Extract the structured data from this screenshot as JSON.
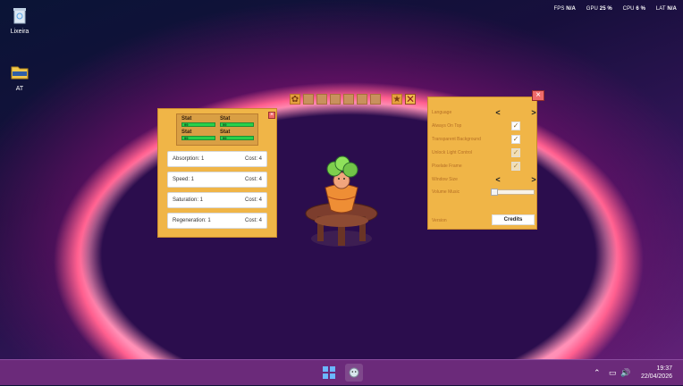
{
  "desktop": {
    "recycle_bin_label": "Lixeira",
    "folder_label": "AT"
  },
  "hud": {
    "fps_label": "FPS",
    "fps_value": "N/A",
    "gpu_label": "GPU",
    "gpu_value": "25 %",
    "cpu_label": "CPU",
    "cpu_value": "6 %",
    "lat_label": "LAT",
    "lat_value": "N/A"
  },
  "stats": {
    "labels": [
      "Stat",
      "Stat",
      "Stat",
      "Stat"
    ],
    "values": [
      "99",
      "99",
      "99",
      "99"
    ]
  },
  "upgrades": [
    {
      "label": "Absorption: 1",
      "cost": "Cost: 4"
    },
    {
      "label": "Speed: 1",
      "cost": "Cost: 4"
    },
    {
      "label": "Saturation: 1",
      "cost": "Cost: 4"
    },
    {
      "label": "Regeneration: 1",
      "cost": "Cost: 4"
    }
  ],
  "settings": {
    "rows": [
      "Language",
      "Always On Top",
      "Transparent Background",
      "Unlock Light Control",
      "Pixelate Frame",
      "Window Size",
      "Volume Music"
    ],
    "version_label": "Version",
    "credits_label": "Credits"
  },
  "taskbar": {
    "time": "19:37",
    "date": "22/04/2026"
  }
}
